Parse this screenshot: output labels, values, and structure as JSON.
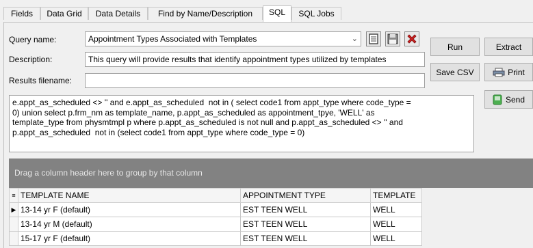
{
  "tabs": [
    {
      "label": "Fields",
      "active": false
    },
    {
      "label": "Data Grid",
      "active": false
    },
    {
      "label": "Data Details",
      "active": false
    },
    {
      "label": "Find by Name/Description",
      "active": false
    },
    {
      "label": "SQL",
      "active": true
    },
    {
      "label": "SQL Jobs",
      "active": false
    }
  ],
  "form": {
    "query_name_label": "Query name:",
    "query_name_value": "Appointment Types Associated with Templates",
    "description_label": "Description:",
    "description_value": "This query will provide results that identify appointment types utilized by templates",
    "results_filename_label": "Results filename:",
    "results_filename_value": ""
  },
  "buttons": {
    "run": "Run",
    "extract": "Extract",
    "save_csv": "Save CSV",
    "print": "Print",
    "send": "Send"
  },
  "sql_text": "e.appt_as_scheduled <> '' and e.appt_as_scheduled  not in ( select code1 from appt_type where code_type =\n0) union select p.frm_nm as template_name, p.appt_as_scheduled as appointment_tpye, 'WELL' as\ntemplate_type from physmtmpl p where p.appt_as_scheduled is not null and p.appt_as_scheduled <> '' and\np.appt_as_scheduled  not in (select code1 from appt_type where code_type = 0)",
  "grid": {
    "group_hint": "Drag a column header here to group by that column",
    "columns": [
      "TEMPLATE NAME",
      "APPOINTMENT TYPE",
      "TEMPLATE"
    ],
    "rows": [
      [
        "13-14 yr F (default)",
        "EST TEEN WELL",
        "WELL"
      ],
      [
        "13-14 yr M (default)",
        "EST TEEN WELL",
        "WELL"
      ],
      [
        "15-17 yr F (default)",
        "EST TEEN WELL",
        "WELL"
      ]
    ]
  },
  "colors": {
    "group_bar": "#828282",
    "delete_icon": "#cc1f1f",
    "send_icon": "#4caf50"
  }
}
